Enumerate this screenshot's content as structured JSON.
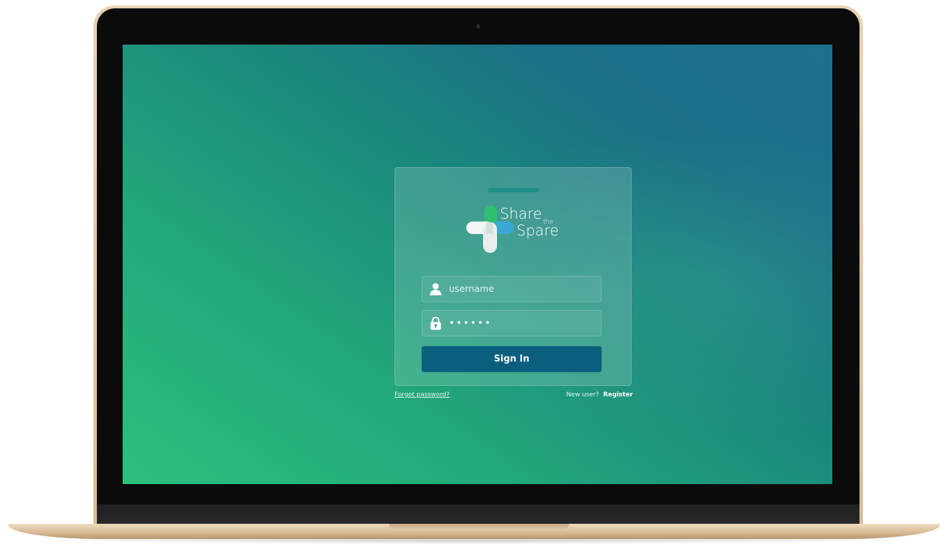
{
  "brand": {
    "logo_line1": "Share",
    "logo_line2": "the",
    "logo_line3": "Spare",
    "colors": {
      "logo_green": "#2fbf71",
      "logo_blue": "#3ba8d8",
      "logo_white": "#ffffff",
      "button": "#0a5f7e",
      "background_start": "#2cc07c",
      "background_end": "#1f6f8f"
    }
  },
  "login": {
    "username_placeholder": "username",
    "password_value": "••••••",
    "username_icon": "user-icon",
    "password_icon": "lock-icon",
    "signin_label": "Sign In"
  },
  "footer_links": {
    "forgot_label": "Forgot password?",
    "new_user_label": "New user?",
    "register_label": "Register"
  }
}
